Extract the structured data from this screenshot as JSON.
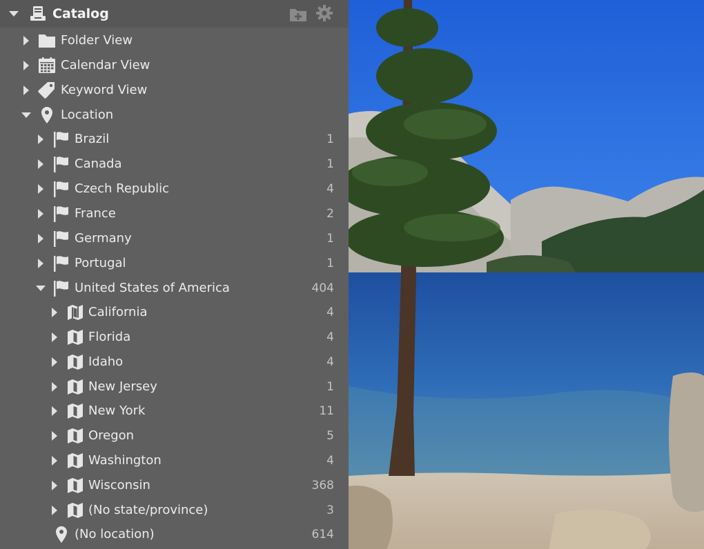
{
  "header": {
    "title": "Catalog",
    "icons": [
      "add-folder-icon",
      "gear-icon"
    ]
  },
  "tree": {
    "folder_view": "Folder View",
    "calendar_view": "Calendar View",
    "keyword_view": "Keyword View",
    "location": "Location",
    "countries": [
      {
        "label": "Brazil",
        "count": "1"
      },
      {
        "label": "Canada",
        "count": "1"
      },
      {
        "label": "Czech Republic",
        "count": "4"
      },
      {
        "label": "France",
        "count": "2"
      },
      {
        "label": "Germany",
        "count": "1"
      },
      {
        "label": "Portugal",
        "count": "1"
      },
      {
        "label": "United States of America",
        "count": "404"
      }
    ],
    "states": [
      {
        "label": "California",
        "count": "4"
      },
      {
        "label": "Florida",
        "count": "4"
      },
      {
        "label": "Idaho",
        "count": "4"
      },
      {
        "label": "New Jersey",
        "count": "1"
      },
      {
        "label": "New York",
        "count": "11"
      },
      {
        "label": "Oregon",
        "count": "5"
      },
      {
        "label": "Washington",
        "count": "4"
      },
      {
        "label": "Wisconsin",
        "count": "368"
      },
      {
        "label": "(No state/province)",
        "count": "3"
      }
    ],
    "no_location": {
      "label": "(No location)",
      "count": "614"
    }
  },
  "colors": {
    "panel": "#5f5f5f",
    "header": "#575757",
    "text": "#ececec",
    "count": "#c4c4c4"
  }
}
